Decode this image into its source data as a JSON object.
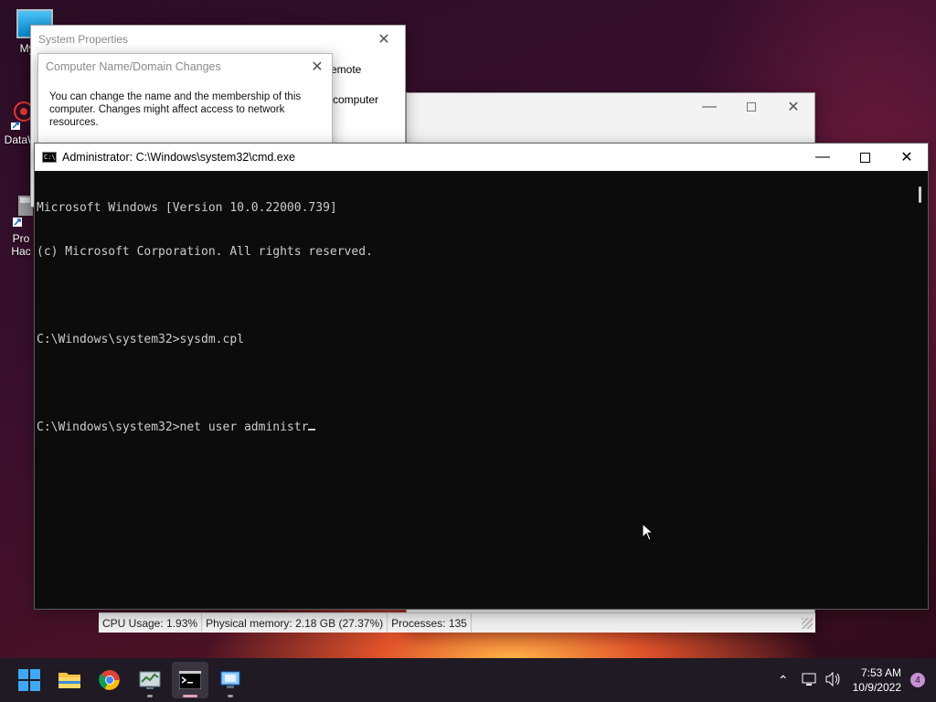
{
  "desktop": {
    "icons": [
      {
        "label": "My Co",
        "icon": "monitor-icon"
      },
      {
        "label": "DataW",
        "icon": "datawrapper-icon"
      },
      {
        "label": "Pro",
        "label2": "Hac",
        "icon": "process-hacker-icon"
      }
    ]
  },
  "system_properties": {
    "title": "System Properties",
    "tab_visible": "emote",
    "computer_word": "computer"
  },
  "domain_dialog": {
    "title": "Computer Name/Domain Changes",
    "text": "You can change the name and the membership of this computer. Changes might affect access to network resources."
  },
  "explorer": {
    "status": {
      "cpu": "CPU Usage: 1.93%",
      "memory": "Physical memory: 2.18 GB (27.37%)",
      "processes": "Processes: 135"
    }
  },
  "cmd": {
    "title": "Administrator: C:\\Windows\\system32\\cmd.exe",
    "lines": [
      "Microsoft Windows [Version 10.0.22000.739]",
      "(c) Microsoft Corporation. All rights reserved.",
      "",
      "C:\\Windows\\system32>sysdm.cpl",
      "",
      "C:\\Windows\\system32>net user administr"
    ]
  },
  "taskbar": {
    "apps": [
      {
        "name": "start-button",
        "icon": "windows-logo-icon"
      },
      {
        "name": "file-explorer",
        "icon": "folder-icon"
      },
      {
        "name": "chrome",
        "icon": "chrome-icon"
      },
      {
        "name": "task-manager",
        "icon": "task-manager-icon"
      },
      {
        "name": "command-prompt",
        "icon": "terminal-icon",
        "active": true
      },
      {
        "name": "remote-desktop",
        "icon": "remote-desktop-icon"
      }
    ],
    "clock_time": "7:53 AM",
    "clock_date": "10/9/2022",
    "notification_count": "4"
  },
  "colors": {
    "console_bg": "#0c0c0c",
    "console_fg": "#cccccc",
    "taskbar_bg": "#1f1a24"
  }
}
